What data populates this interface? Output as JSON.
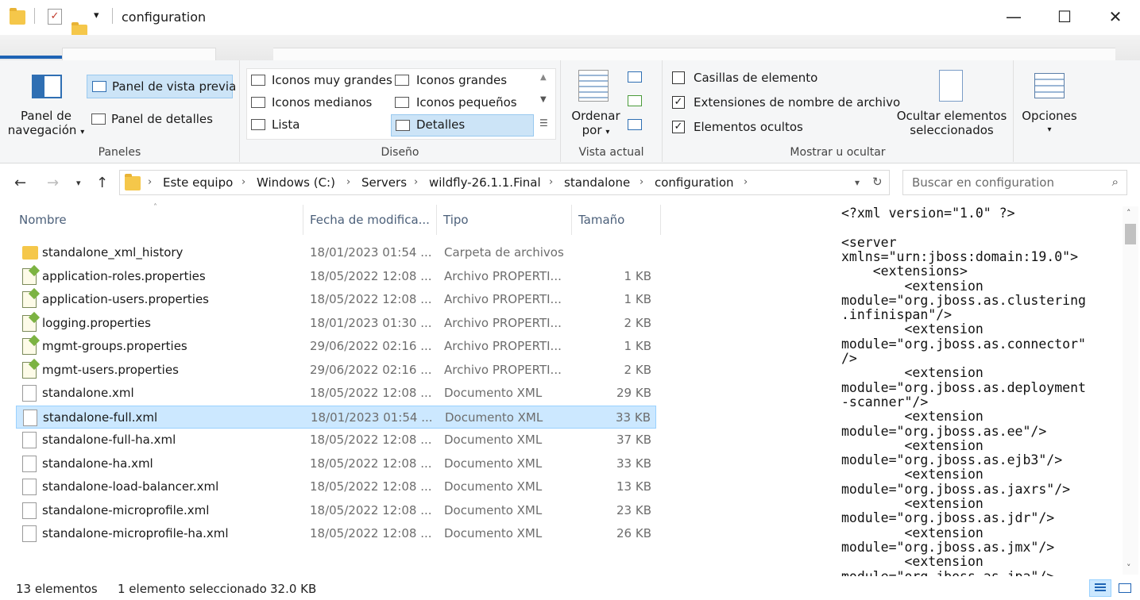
{
  "window": {
    "title": "configuration",
    "minimize_glyph": "—",
    "maximize_glyph": "☐",
    "close_glyph": "✕"
  },
  "ribbon": {
    "paneles": {
      "nav_pane_line1": "Panel de",
      "nav_pane_line2": "navegación",
      "preview_pane": "Panel de vista previa",
      "details_pane": "Panel de detalles",
      "label": "Paneles"
    },
    "diseno": {
      "items": [
        "Iconos muy grandes",
        "Iconos grandes",
        "Iconos medianos",
        "Iconos pequeños",
        "Lista",
        "Detalles"
      ],
      "selected": "Detalles",
      "label": "Diseño"
    },
    "vista_actual": {
      "sort_line1": "Ordenar",
      "sort_line2": "por",
      "label": "Vista actual"
    },
    "mostrar": {
      "checkboxes": [
        {
          "label": "Casillas de elemento",
          "checked": false
        },
        {
          "label": "Extensiones de nombre de archivo",
          "checked": true
        },
        {
          "label": "Elementos ocultos",
          "checked": true
        }
      ],
      "hide_line1": "Ocultar elementos",
      "hide_line2": "seleccionados",
      "label": "Mostrar u ocultar"
    },
    "opciones": {
      "label": "Opciones"
    }
  },
  "address": {
    "crumbs": [
      "Este equipo",
      "Windows (C:)",
      "Servers",
      "wildfly-26.1.1.Final",
      "standalone",
      "configuration"
    ],
    "search_placeholder": "Buscar en configuration"
  },
  "columns": {
    "name": "Nombre",
    "date": "Fecha de modifica...",
    "type": "Tipo",
    "size": "Tamaño"
  },
  "files": [
    {
      "name": "standalone_xml_history",
      "date": "18/01/2023 01:54 ...",
      "type": "Carpeta de archivos",
      "size": "",
      "icon": "folder"
    },
    {
      "name": "application-roles.properties",
      "date": "18/05/2022 12:08 ...",
      "type": "Archivo PROPERTI...",
      "size": "1 KB",
      "icon": "prop"
    },
    {
      "name": "application-users.properties",
      "date": "18/05/2022 12:08 ...",
      "type": "Archivo PROPERTI...",
      "size": "1 KB",
      "icon": "prop"
    },
    {
      "name": "logging.properties",
      "date": "18/01/2023 01:30 ...",
      "type": "Archivo PROPERTI...",
      "size": "2 KB",
      "icon": "prop"
    },
    {
      "name": "mgmt-groups.properties",
      "date": "29/06/2022 02:16 ...",
      "type": "Archivo PROPERTI...",
      "size": "1 KB",
      "icon": "prop"
    },
    {
      "name": "mgmt-users.properties",
      "date": "29/06/2022 02:16 ...",
      "type": "Archivo PROPERTI...",
      "size": "2 KB",
      "icon": "prop"
    },
    {
      "name": "standalone.xml",
      "date": "18/05/2022 12:08 ...",
      "type": "Documento XML",
      "size": "29 KB",
      "icon": "doc"
    },
    {
      "name": "standalone-full.xml",
      "date": "18/01/2023 01:54 ...",
      "type": "Documento XML",
      "size": "33 KB",
      "icon": "doc",
      "selected": true
    },
    {
      "name": "standalone-full-ha.xml",
      "date": "18/05/2022 12:08 ...",
      "type": "Documento XML",
      "size": "37 KB",
      "icon": "doc"
    },
    {
      "name": "standalone-ha.xml",
      "date": "18/05/2022 12:08 ...",
      "type": "Documento XML",
      "size": "33 KB",
      "icon": "doc"
    },
    {
      "name": "standalone-load-balancer.xml",
      "date": "18/05/2022 12:08 ...",
      "type": "Documento XML",
      "size": "13 KB",
      "icon": "doc"
    },
    {
      "name": "standalone-microprofile.xml",
      "date": "18/05/2022 12:08 ...",
      "type": "Documento XML",
      "size": "23 KB",
      "icon": "doc"
    },
    {
      "name": "standalone-microprofile-ha.xml",
      "date": "18/05/2022 12:08 ...",
      "type": "Documento XML",
      "size": "26 KB",
      "icon": "doc"
    }
  ],
  "preview_lines": [
    "<?xml version=\"1.0\" ?>",
    "",
    "<server",
    "xmlns=\"urn:jboss:domain:19.0\">",
    "    <extensions>",
    "        <extension",
    "module=\"org.jboss.as.clustering",
    ".infinispan\"/>",
    "        <extension",
    "module=\"org.jboss.as.connector\"",
    "/>",
    "        <extension",
    "module=\"org.jboss.as.deployment",
    "-scanner\"/>",
    "        <extension",
    "module=\"org.jboss.as.ee\"/>",
    "        <extension",
    "module=\"org.jboss.as.ejb3\"/>",
    "        <extension",
    "module=\"org.jboss.as.jaxrs\"/>",
    "        <extension",
    "module=\"org.jboss.as.jdr\"/>",
    "        <extension",
    "module=\"org.jboss.as.jmx\"/>",
    "        <extension",
    "module=\"org.jboss.as.jpa\"/>"
  ],
  "status": {
    "count": "13 elementos",
    "selection": "1 elemento seleccionado",
    "size": "32.0 KB"
  }
}
